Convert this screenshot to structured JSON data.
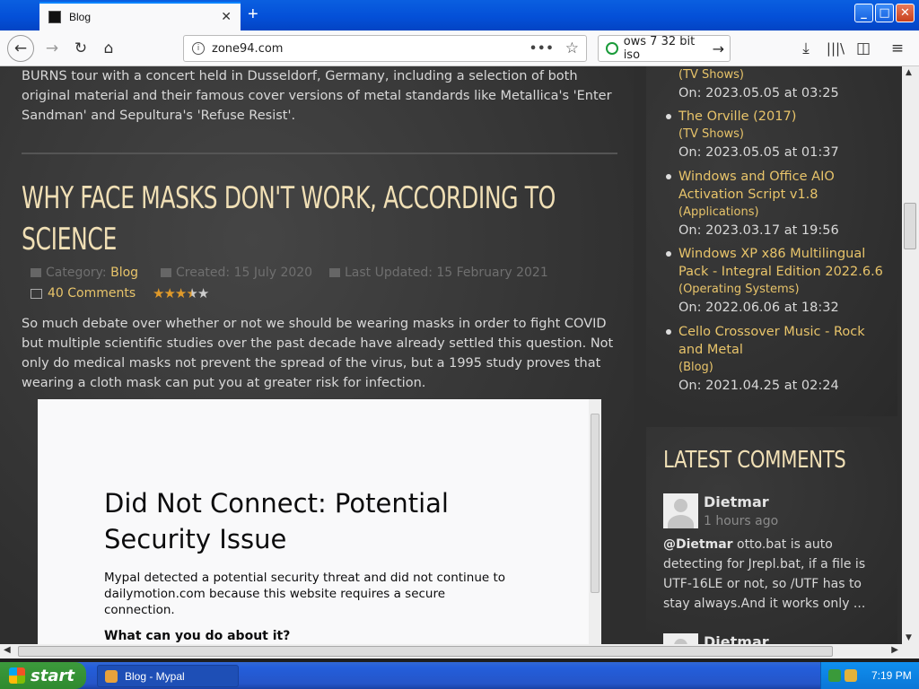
{
  "browser": {
    "tab_title": "Blog",
    "url": "zone94.com",
    "search_text": "ows 7 32 bit iso"
  },
  "article": {
    "prev_text": "BURNS tour with a concert held in Dusseldorf, Germany, including a selection of both original material and their famous cover versions of metal standards like Metallica's 'Enter Sandman' and Sepultura's 'Refuse Resist'.",
    "title": "WHY FACE MASKS DON'T WORK, ACCORDING TO SCIENCE",
    "category_label": "Category:",
    "category": "Blog",
    "created": "Created: 15 July 2020",
    "updated": "Last Updated: 15 February 2021",
    "comments": "40 Comments",
    "rating": 3.5,
    "body": "So much debate over whether or not we should be wearing masks in order to fight COVID but multiple scientific studies over the past decade have already settled this question. Not only do medical masks not prevent the spread of the virus, but a 1995 study proves that wearing a cloth mask can put you at greater risk for infection."
  },
  "embed_error": {
    "title": "Did Not Connect: Potential Security Issue",
    "description": "Mypal detected a potential security threat and did not continue to dailymotion.com because this website requires a secure connection.",
    "question": "What can you do about it?"
  },
  "sidebar": {
    "items": [
      {
        "title": "",
        "category": "(TV Shows)",
        "date": "On: 2023.05.05 at 03:25"
      },
      {
        "title": "The Orville (2017)",
        "category": "(TV Shows)",
        "date": "On: 2023.05.05 at 01:37"
      },
      {
        "title": "Windows and Office AIO Activation Script v1.8",
        "category": "(Applications)",
        "date": "On: 2023.03.17 at 19:56"
      },
      {
        "title": "Windows XP x86 Multilingual Pack - Integral Edition 2022.6.6",
        "category": "(Operating Systems)",
        "date": "On: 2022.06.06 at 18:32"
      },
      {
        "title": "Cello Crossover Music - Rock and Metal",
        "category": "(Blog)",
        "date": "On: 2021.04.25 at 02:24"
      }
    ],
    "latest_comments_title": "LATEST COMMENTS",
    "comments": [
      {
        "author": "Dietmar",
        "ago": "1 hours ago",
        "mention": "@Dietmar",
        "text": " otto.bat is auto detecting for Jrepl.bat, if a file is UTF-16LE or not, so /UTF has to stay always.And it works only ..."
      },
      {
        "author": "Dietmar"
      }
    ]
  },
  "taskbar": {
    "start": "start",
    "task": "Blog - Mypal",
    "time": "7:19 PM"
  }
}
